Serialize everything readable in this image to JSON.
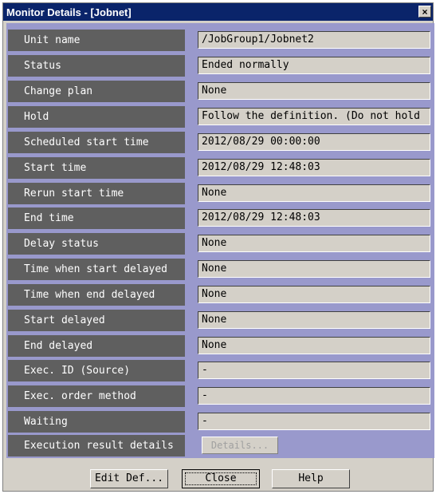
{
  "window": {
    "title": "Monitor Details - [Jobnet]",
    "close_glyph": "×"
  },
  "rows": [
    {
      "label": "Unit name",
      "value": "/JobGroup1/Jobnet2"
    },
    {
      "label": "Status",
      "value": "Ended normally"
    },
    {
      "label": "Change plan",
      "value": "None"
    },
    {
      "label": "Hold",
      "value": "Follow the definition. (Do not hold"
    },
    {
      "label": "Scheduled start time",
      "value": "2012/08/29 00:00:00"
    },
    {
      "label": "Start time",
      "value": "2012/08/29 12:48:03"
    },
    {
      "label": "Rerun start time",
      "value": "None"
    },
    {
      "label": "End time",
      "value": "2012/08/29 12:48:03"
    },
    {
      "label": "Delay status",
      "value": "None"
    },
    {
      "label": "Time when start delayed",
      "value": "None"
    },
    {
      "label": "Time when end delayed",
      "value": "None"
    },
    {
      "label": "Start delayed",
      "value": "None"
    },
    {
      "label": "End delayed",
      "value": "None"
    },
    {
      "label": "Exec. ID (Source)",
      "value": "-"
    },
    {
      "label": "Exec. order method",
      "value": "-"
    },
    {
      "label": "Waiting",
      "value": "-"
    }
  ],
  "execution_result": {
    "label": "Execution result details",
    "button": "Details..."
  },
  "buttons": {
    "edit_def": "Edit Def...",
    "close": "Close",
    "help": "Help"
  }
}
